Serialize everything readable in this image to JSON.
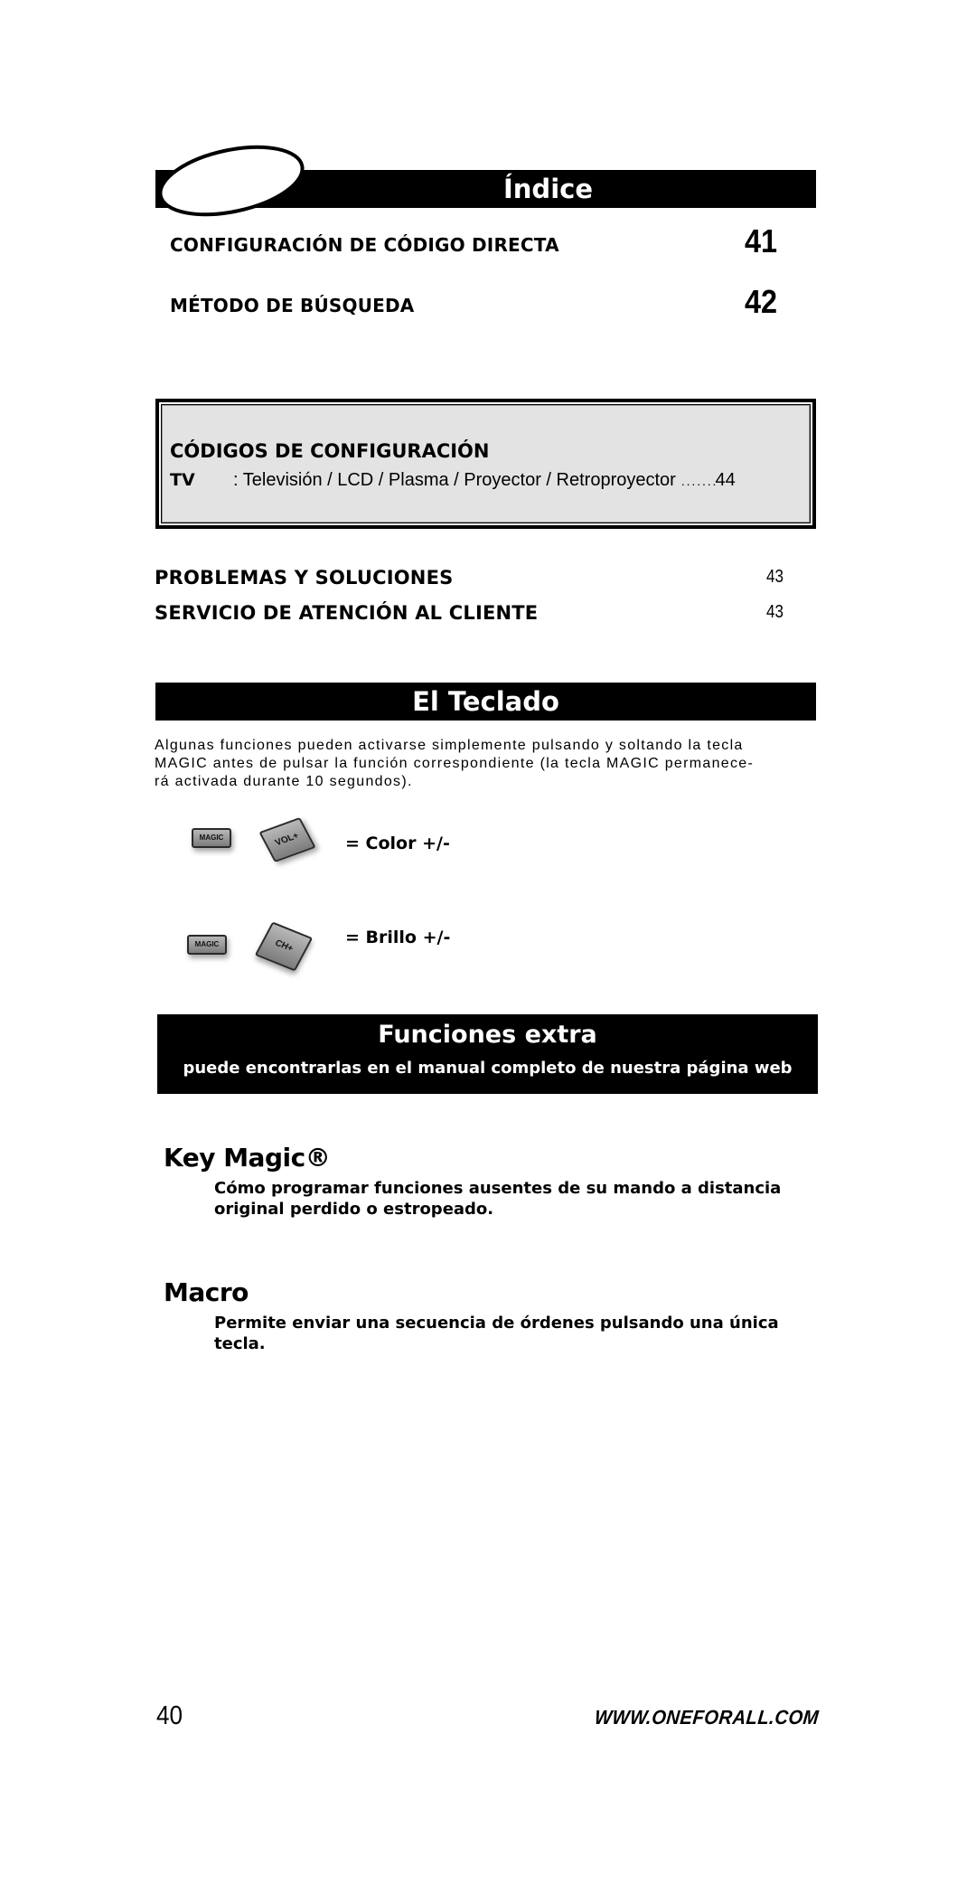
{
  "index": {
    "title": "Índice",
    "entries": [
      {
        "label": "CONFIGURACIÓN DE CÓDIGO DIRECTA",
        "page": "41"
      },
      {
        "label": "MÉTODO DE BÚSQUEDA",
        "page": "42"
      }
    ]
  },
  "codes_box": {
    "heading": "CÓDIGOS DE CONFIGURACIÓN",
    "rows": [
      {
        "device": "TV",
        "description": ": Televisión / LCD / Plasma / Proyector / Retroproyector",
        "leader": ". . . . . . .",
        "page": "44"
      }
    ]
  },
  "more_entries": [
    {
      "label": "PROBLEMAS Y SOLUCIONES",
      "page": "43"
    },
    {
      "label": "SERVICIO DE ATENCIÓN AL CLIENTE",
      "page": "43"
    }
  ],
  "keyboard": {
    "title": "El Teclado",
    "paragraph_lines": [
      "Algunas funciones pueden activarse simplemente pulsando y soltando la tecla",
      "MAGIC antes de pulsar la función correspondiente (la tecla MAGIC permanece-",
      "rá activada durante 10 segundos)."
    ],
    "combos": [
      {
        "key1": "MAGIC",
        "key2": "VOL+",
        "result": "= Color +/-"
      },
      {
        "key1": "MAGIC",
        "key2": "CH+",
        "result": "= Brillo +/-"
      }
    ]
  },
  "extras": {
    "title": "Funciones extra",
    "subtitle": "puede encontrarlas en el manual completo de nuestra página web",
    "features": [
      {
        "title": "Key Magic®",
        "description_lines": [
          "Cómo programar funciones ausentes de su mando a distancia",
          "original perdido o estropeado."
        ]
      },
      {
        "title": "Macro",
        "description_lines": [
          "Permite enviar una secuencia de órdenes pulsando una única",
          "tecla."
        ]
      }
    ]
  },
  "footer": {
    "page_number": "40",
    "website": "WWW.ONEFORALL.COM"
  },
  "colors": {
    "bar": "#000000",
    "box_fill": "#e3e3e3",
    "text": "#000000"
  }
}
